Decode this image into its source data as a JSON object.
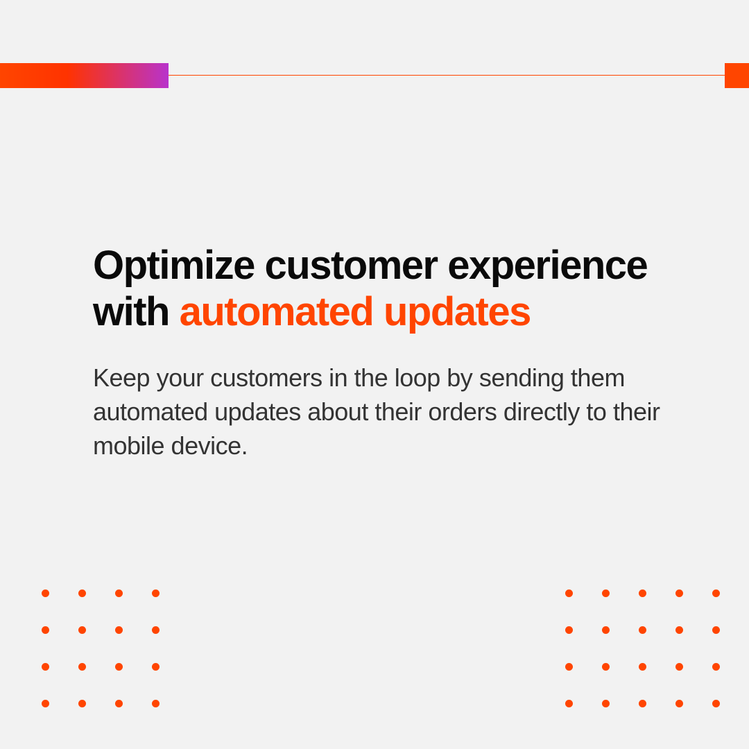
{
  "heading": {
    "text_prefix": "Optimize customer experience with ",
    "text_highlight": "automated updates"
  },
  "body": {
    "text": "Keep your customers in the loop by sending them automated updates about their orders directly to their mobile device."
  },
  "colors": {
    "accent": "#ff4500",
    "gradient_start": "#ff4500",
    "gradient_end": "#b833cc",
    "background": "#f2f2f2",
    "text_dark": "#0a0a0a",
    "text_body": "#333333"
  }
}
